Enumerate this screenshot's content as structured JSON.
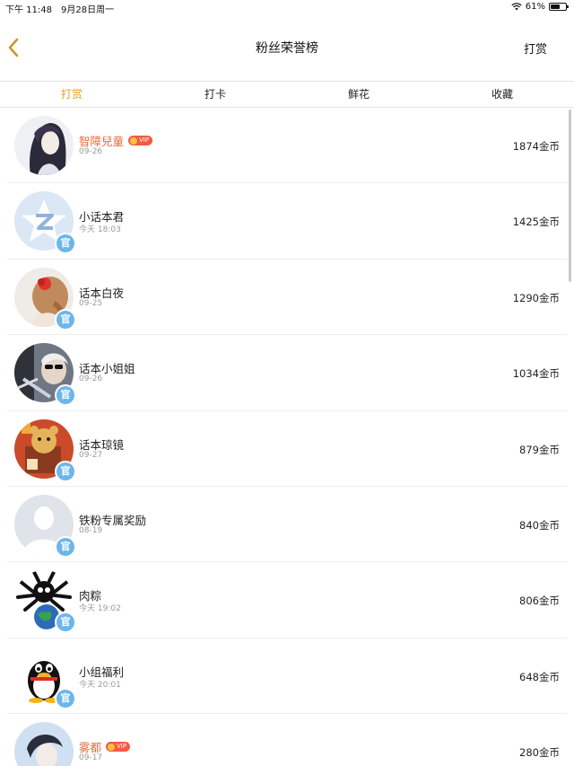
{
  "status_bar": {
    "time": "下午 11:48",
    "date": "9月28日周一",
    "battery": "61%",
    "battery_level": 0.61
  },
  "header": {
    "title": "粉丝荣誉榜",
    "action_label": "打赏"
  },
  "tabs": [
    {
      "label": "打赏",
      "active": true
    },
    {
      "label": "打卡",
      "active": false
    },
    {
      "label": "鲜花",
      "active": false
    },
    {
      "label": "收藏",
      "active": false
    }
  ],
  "badge_text": {
    "vip": "VIP",
    "official": "官"
  },
  "fans": [
    {
      "name": "智障兒童",
      "date": "09-26",
      "amount": "1874金币",
      "vip": true,
      "official": false,
      "avatar": "anime-girl"
    },
    {
      "name": "小话本君",
      "date": "今天 18:03",
      "amount": "1425金币",
      "vip": false,
      "official": true,
      "avatar": "qq-zone-star"
    },
    {
      "name": "话本白夜",
      "date": "09-25",
      "amount": "1290金币",
      "vip": false,
      "official": true,
      "avatar": "flower-hair"
    },
    {
      "name": "话本小姐姐",
      "date": "09-26",
      "amount": "1034金币",
      "vip": false,
      "official": true,
      "avatar": "sunglasses-person"
    },
    {
      "name": "话本琼镜",
      "date": "09-27",
      "amount": "879金币",
      "vip": false,
      "official": true,
      "avatar": "cartoon-bear"
    },
    {
      "name": "铁粉专属奖励",
      "date": "08-19",
      "amount": "840金币",
      "vip": false,
      "official": true,
      "avatar": "default-person"
    },
    {
      "name": "肉粽",
      "date": "今天 19:02",
      "amount": "806金币",
      "vip": false,
      "official": true,
      "avatar": "ghost-globe"
    },
    {
      "name": "小组福利",
      "date": "今天 20:01",
      "amount": "648金币",
      "vip": false,
      "official": true,
      "avatar": "qq-penguin"
    },
    {
      "name": "雾都",
      "date": "09-17",
      "amount": "280金币",
      "vip": true,
      "official": false,
      "avatar": "anime-boy"
    }
  ]
}
